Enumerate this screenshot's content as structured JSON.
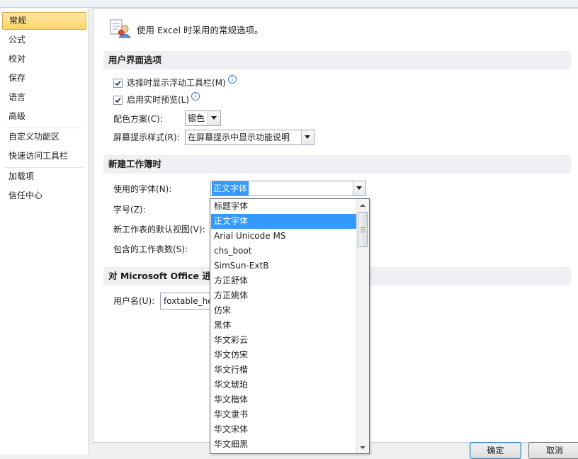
{
  "nav": {
    "items": [
      "常规",
      "公式",
      "校对",
      "保存",
      "语言",
      "高级",
      "自定义功能区",
      "快速访问工具栏",
      "加载项",
      "信任中心"
    ],
    "selected": "常规"
  },
  "header": {
    "text": "使用 Excel 时采用的常规选项。"
  },
  "ui_section": {
    "title": "用户界面选项",
    "show_toolbar_label": "选择时显示浮动工具栏(M)",
    "show_toolbar_checked": true,
    "live_preview_label": "启用实时预览(L)",
    "live_preview_checked": true,
    "color_scheme_label": "配色方案(C):",
    "color_scheme_value": "银色",
    "screentip_label": "屏幕提示样式(R):",
    "screentip_value": "在屏幕提示中显示功能说明"
  },
  "workbook_section": {
    "title": "新建工作簿时",
    "font_label": "使用的字体(N):",
    "font_value": "正文字体",
    "size_label": "字号(Z):",
    "view_label": "新工作表的默认视图(V):",
    "sheets_label": "包含的工作表数(S):"
  },
  "office_section": {
    "title": "对 Microsoft Office 进行",
    "username_label": "用户名(U):",
    "username_value": "foxtable_hel"
  },
  "font_dropdown": {
    "items": [
      "标题字体",
      "正文字体",
      "Arial Unicode MS",
      "chs_boot",
      "SimSun-ExtB",
      "方正舒体",
      "方正姚体",
      "仿宋",
      "黑体",
      "华文彩云",
      "华文仿宋",
      "华文行楷",
      "华文琥珀",
      "华文楷体",
      "华文隶书",
      "华文宋体",
      "华文细黑"
    ],
    "selected": "正文字体"
  },
  "buttons": {
    "ok": "确定",
    "cancel": "取消"
  },
  "colors": {
    "selection": "#3399ff",
    "nav_selected": "#ffd567",
    "section_bg": "#eef0f3"
  },
  "icons": [
    "options-general-icon",
    "info-icon",
    "checkmark-icon",
    "dropdown-arrow-icon",
    "scroll-up-icon",
    "scroll-down-icon"
  ]
}
